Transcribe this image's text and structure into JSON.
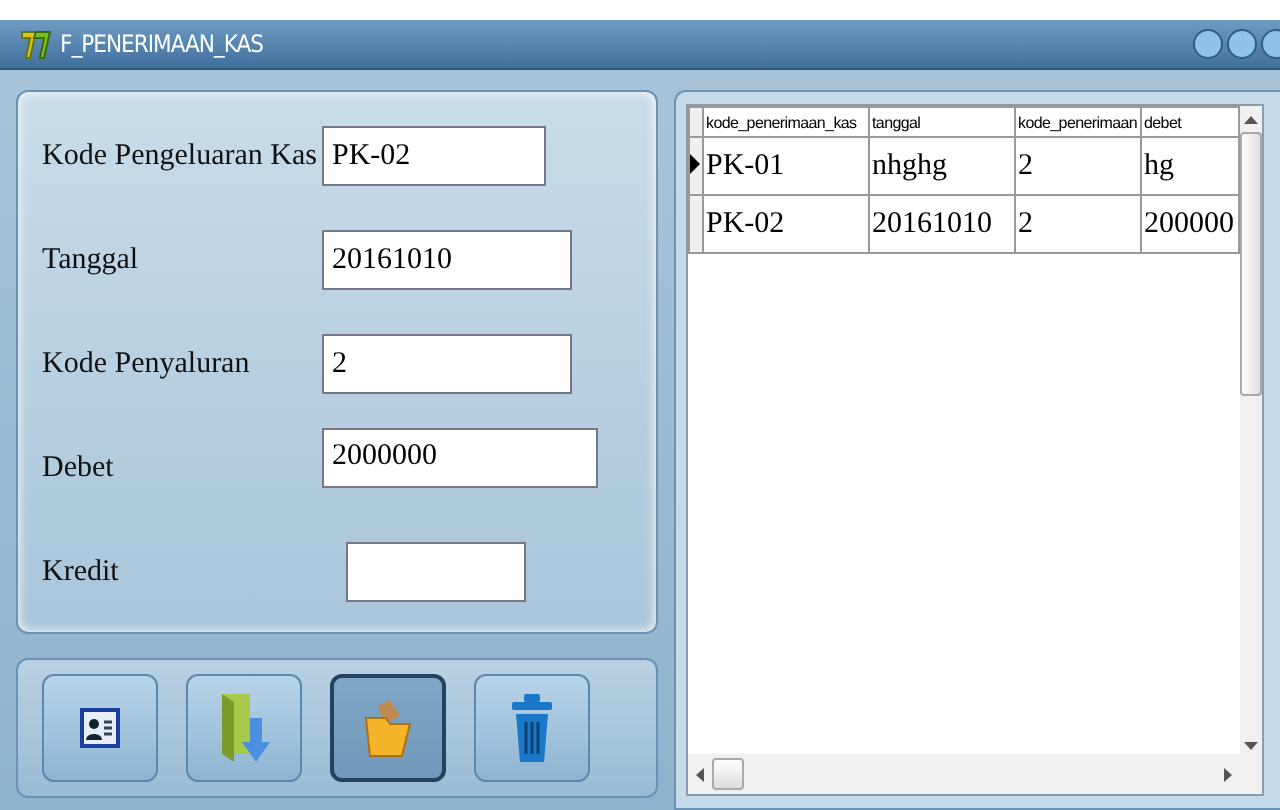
{
  "window": {
    "title": "F_PENERIMAAN_KAS"
  },
  "form": {
    "fields": [
      {
        "label": "Kode Pengeluaran Kas",
        "value": "PK-02"
      },
      {
        "label": "Tanggal",
        "value": "20161010"
      },
      {
        "label": "Kode Penyaluran",
        "value": "2"
      },
      {
        "label": "Debet",
        "value": "2000000"
      },
      {
        "label": "Kredit"
      }
    ]
  },
  "toolbar": {
    "buttons": [
      {
        "kind": "contact",
        "pressed": false
      },
      {
        "kind": "import",
        "pressed": false
      },
      {
        "kind": "open",
        "pressed": true
      },
      {
        "kind": "delete",
        "pressed": false
      }
    ]
  },
  "table": {
    "columns": [
      "kode_penerimaan_kas",
      "tanggal",
      "kode_penerimaan",
      "debet"
    ],
    "rows": [
      {
        "current": true,
        "cells": [
          "PK-01",
          "nhghg",
          "2",
          "hg"
        ]
      },
      {
        "current": false,
        "cells": [
          "PK-02",
          "20161010",
          "2",
          "200000"
        ]
      }
    ]
  }
}
